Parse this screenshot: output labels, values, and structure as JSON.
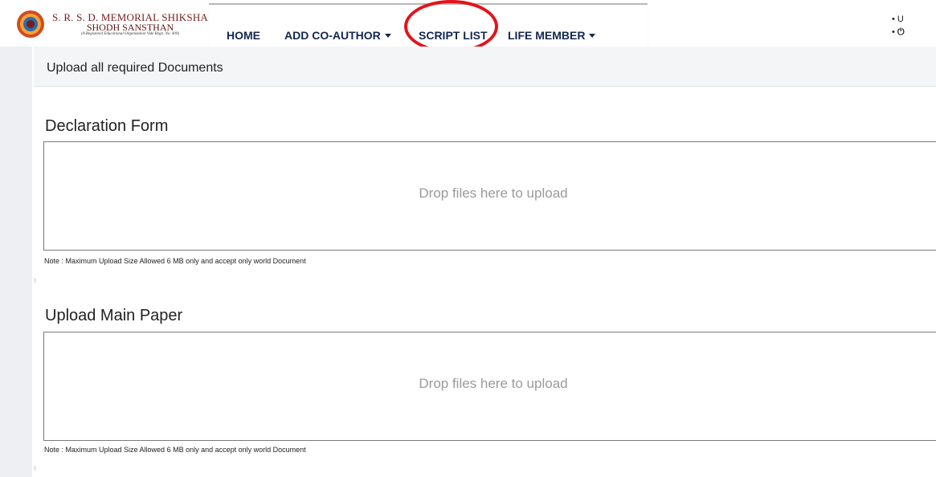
{
  "brand": {
    "line1": "S. R. S. D. MEMORIAL SHIKSHA",
    "line2": "SHODH SANSTHAN",
    "line3": "(A Registered Educational Organization Vide Regn. No. 409)"
  },
  "nav": {
    "items": [
      {
        "label": "HOME",
        "dropdown": false
      },
      {
        "label": "ADD CO-AUTHOR",
        "dropdown": true
      },
      {
        "label": "SCRIPT LIST",
        "dropdown": false
      },
      {
        "label": "LIFE MEMBER",
        "dropdown": true
      }
    ],
    "highlighted": "SCRIPT LIST",
    "highlight_color": "#e3131b"
  },
  "user_menu": {
    "item1": "U",
    "item2_icon": "power-icon"
  },
  "page": {
    "header": "Upload all required Documents"
  },
  "sections": [
    {
      "title": "Declaration Form",
      "dropzone_text": "Drop files here to upload",
      "note": "Note : Maximum Upload Size Allowed 6 MB only and accept only world Document"
    },
    {
      "title": "Upload Main Paper",
      "dropzone_text": "Drop files here to upload",
      "note": "Note : Maximum Upload Size Allowed 6 MB only and accept only world Document"
    }
  ],
  "colors": {
    "nav_text": "#132850",
    "brand_text": "#7a1c1c",
    "side_rail": "#eeeff2",
    "title_bar": "#f4f5f7"
  }
}
